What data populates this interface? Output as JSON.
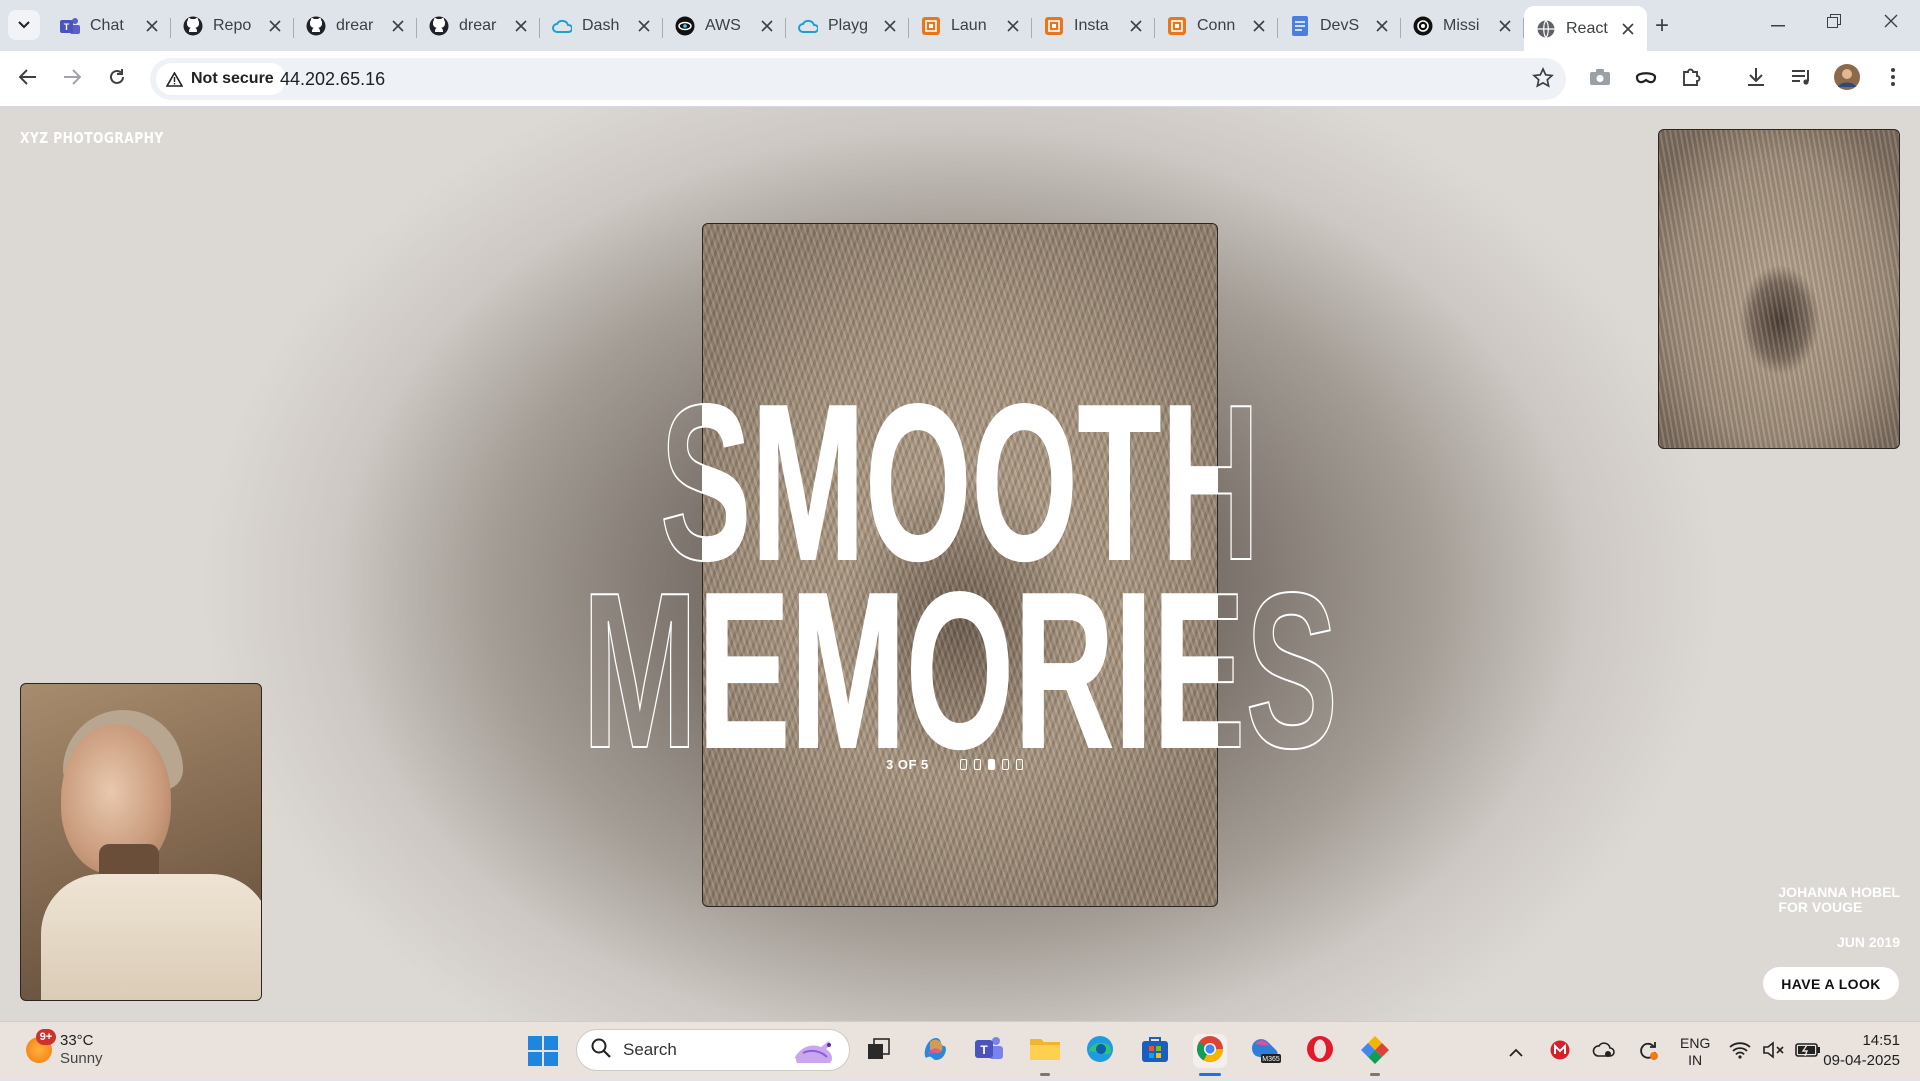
{
  "browser": {
    "tabs": [
      {
        "label": "Chat",
        "icon": "teams-icon",
        "color": "#5b5fc7"
      },
      {
        "label": "Repo",
        "icon": "github-icon",
        "color": "#1f2328"
      },
      {
        "label": "drear",
        "icon": "github-icon",
        "color": "#1f2328"
      },
      {
        "label": "drear",
        "icon": "github-icon",
        "color": "#1f2328"
      },
      {
        "label": "Dash",
        "icon": "cloud-icon",
        "color": "#1aa3c9"
      },
      {
        "label": "AWS",
        "icon": "eye-icon",
        "color": "#111111"
      },
      {
        "label": "Playg",
        "icon": "cloud-icon",
        "color": "#1aa3c9"
      },
      {
        "label": "Laun",
        "icon": "aws-ec2-icon",
        "color": "#e8761a"
      },
      {
        "label": "Insta",
        "icon": "aws-ec2-icon",
        "color": "#e8761a"
      },
      {
        "label": "Conn",
        "icon": "aws-ec2-icon",
        "color": "#e8761a"
      },
      {
        "label": "DevS",
        "icon": "docs-icon",
        "color": "#4a7fe0"
      },
      {
        "label": "Missi",
        "icon": "openai-icon",
        "color": "#111111"
      },
      {
        "label": "React",
        "icon": "globe-icon",
        "color": "#5f6368",
        "active": true
      }
    ],
    "security_label": "Not secure",
    "url": "44.202.65.16"
  },
  "page": {
    "brand": "XYZ PHOTOGRAPHY",
    "headline_line1": "SMOOTH",
    "headline_line2": "MEMORIES",
    "counter": "3 OF 5",
    "slides_total": 5,
    "slide_current": 3,
    "credit_line1": "JOHANNA HOBEL",
    "credit_line2": "FOR VOUGE",
    "date": "JUN 2019",
    "cta_label": "HAVE A LOOK"
  },
  "taskbar": {
    "weather_badge": "9+",
    "temperature": "33°C",
    "condition": "Sunny",
    "search_label": "Search",
    "language_line1": "ENG",
    "language_line2": "IN",
    "time": "14:51",
    "date": "09-04-2025"
  }
}
